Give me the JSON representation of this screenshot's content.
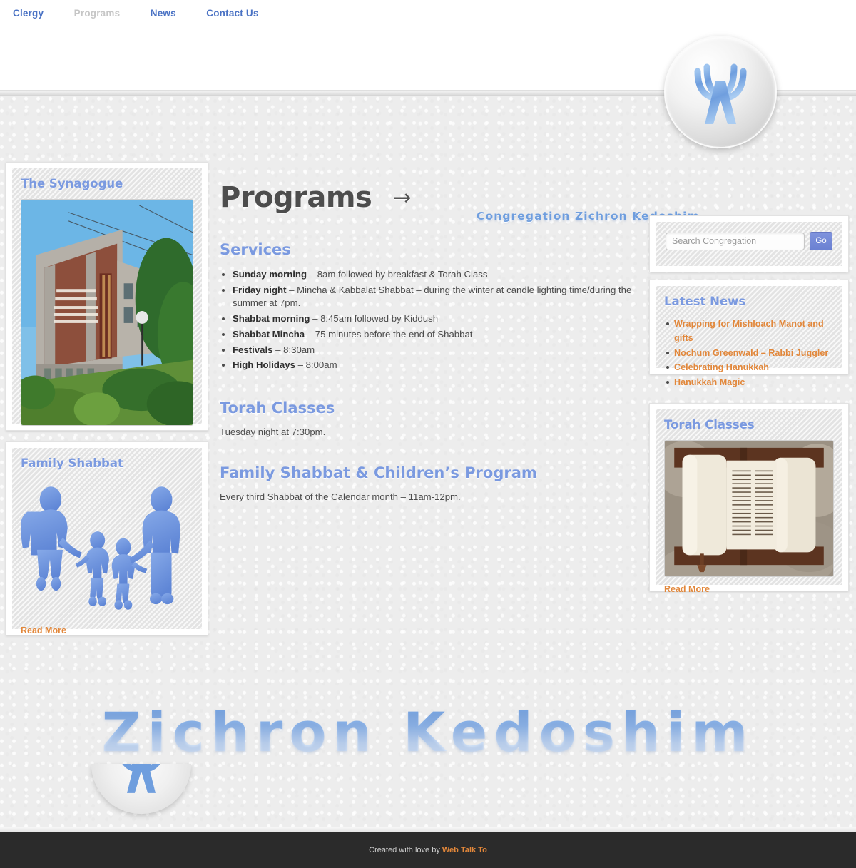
{
  "nav": {
    "items": [
      {
        "label": "Clergy",
        "active": false
      },
      {
        "label": "Programs",
        "active": true
      },
      {
        "label": "News",
        "active": false
      },
      {
        "label": "Contact Us",
        "active": false
      }
    ]
  },
  "header": {
    "site_title": "Congregation Zichron Kedoshim",
    "logo_icon": "menorah-icon"
  },
  "content": {
    "page_title": "Programs",
    "title_arrow": "→",
    "sections": [
      {
        "heading": "Services",
        "items": [
          {
            "term": "Sunday morning",
            "detail": " – 8am followed by breakfast & Torah Class"
          },
          {
            "term": "Friday night",
            "detail": " – Mincha & Kabbalat Shabbat – during the winter at candle lighting time/during the summer at 7pm."
          },
          {
            "term": "Shabbat morning",
            "detail": " – 8:45am followed by Kiddush"
          },
          {
            "term": "Shabbat Mincha",
            "detail": " – 75 minutes before the end of Shabbat"
          },
          {
            "term": "Festivals",
            "detail": " – 8:30am"
          },
          {
            "term": "High Holidays",
            "detail": " – 8:00am"
          }
        ]
      },
      {
        "heading": "Torah Classes",
        "paragraph": "Tuesday night at 7:30pm."
      },
      {
        "heading": "Family Shabbat & Children’s Program",
        "paragraph": "Every third Shabbat of the Calendar month – 11am-12pm."
      }
    ]
  },
  "left_sidebar": {
    "synagogue": {
      "title": "The Synagogue",
      "image_alt": "synagogue-building-photo"
    },
    "family": {
      "title": "Family Shabbat",
      "image_alt": "family-silhouette-illustration",
      "read_more": "Read More"
    }
  },
  "right_sidebar": {
    "search": {
      "placeholder": "Search Congregation",
      "value": "",
      "button_label": "Go"
    },
    "news": {
      "title": "Latest News",
      "items": [
        "Wrapping for Mishloach Manot and gifts",
        "Nochum Greenwald – Rabbi Juggler",
        "Celebrating Hanukkah",
        "Hanukkah Magic"
      ]
    },
    "torah": {
      "title": "Torah Classes",
      "image_alt": "open-torah-scroll-photo",
      "read_more": "Read More"
    }
  },
  "footer": {
    "wordmark": "Zichron Kedoshim",
    "badge_icon": "menorah-icon",
    "credit_prefix": "Created with love by ",
    "credit_link": "Web Talk To"
  },
  "colors": {
    "accent_blue": "#7b9ae0",
    "nav_blue": "#4a72c4",
    "accent_orange": "#e2873a",
    "footer_dark": "#2b2b2b",
    "page_bg": "#ededed"
  }
}
